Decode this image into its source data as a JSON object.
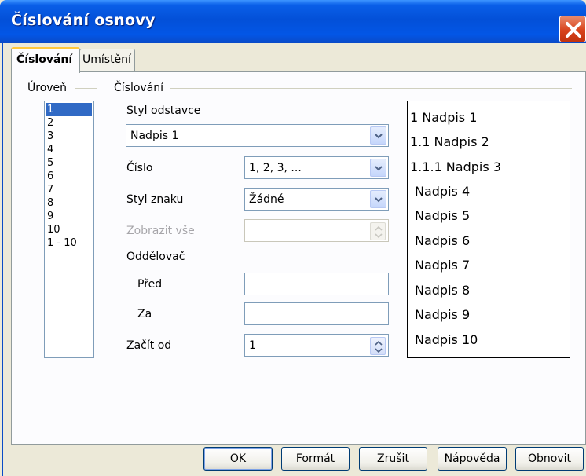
{
  "window": {
    "title": "Číslování osnovy"
  },
  "tabs": [
    {
      "label": "Číslování",
      "active": true
    },
    {
      "label": "Umístění",
      "active": false
    }
  ],
  "level_section": {
    "label": "Úroveň",
    "items": [
      "1",
      "2",
      "3",
      "4",
      "5",
      "6",
      "7",
      "8",
      "9",
      "10",
      "1 - 10"
    ],
    "selected": "1"
  },
  "numbering_section": {
    "label": "Číslování",
    "paragraph_style": {
      "label": "Styl odstavce",
      "value": "Nadpis 1"
    },
    "number": {
      "label": "Číslo",
      "value": "1, 2, 3, ..."
    },
    "char_style": {
      "label": "Styl znaku",
      "value": "Žádné"
    },
    "show_all": {
      "label": "Zobrazit vše",
      "value": ""
    },
    "separator": {
      "label": "Oddělovač",
      "before_label": "Před",
      "before_value": "",
      "after_label": "Za",
      "after_value": ""
    },
    "start_at": {
      "label": "Začít od",
      "value": "1"
    }
  },
  "preview": {
    "lines": [
      "1 Nadpis 1",
      "1.1 Nadpis 2",
      "1.1.1 Nadpis 3",
      "Nadpis 4",
      "Nadpis 5",
      "Nadpis 6",
      "Nadpis 7",
      "Nadpis 8",
      "Nadpis 9",
      "Nadpis 10"
    ]
  },
  "buttons": {
    "ok": "OK",
    "format": "Formát",
    "cancel": "Zrušit",
    "help": "Nápověda",
    "reset": "Obnovit"
  },
  "colors": {
    "titlebar": "#0350d8",
    "selection": "#316ac5",
    "tab_highlight": "#ffc83c",
    "close_button": "#d8431c"
  }
}
